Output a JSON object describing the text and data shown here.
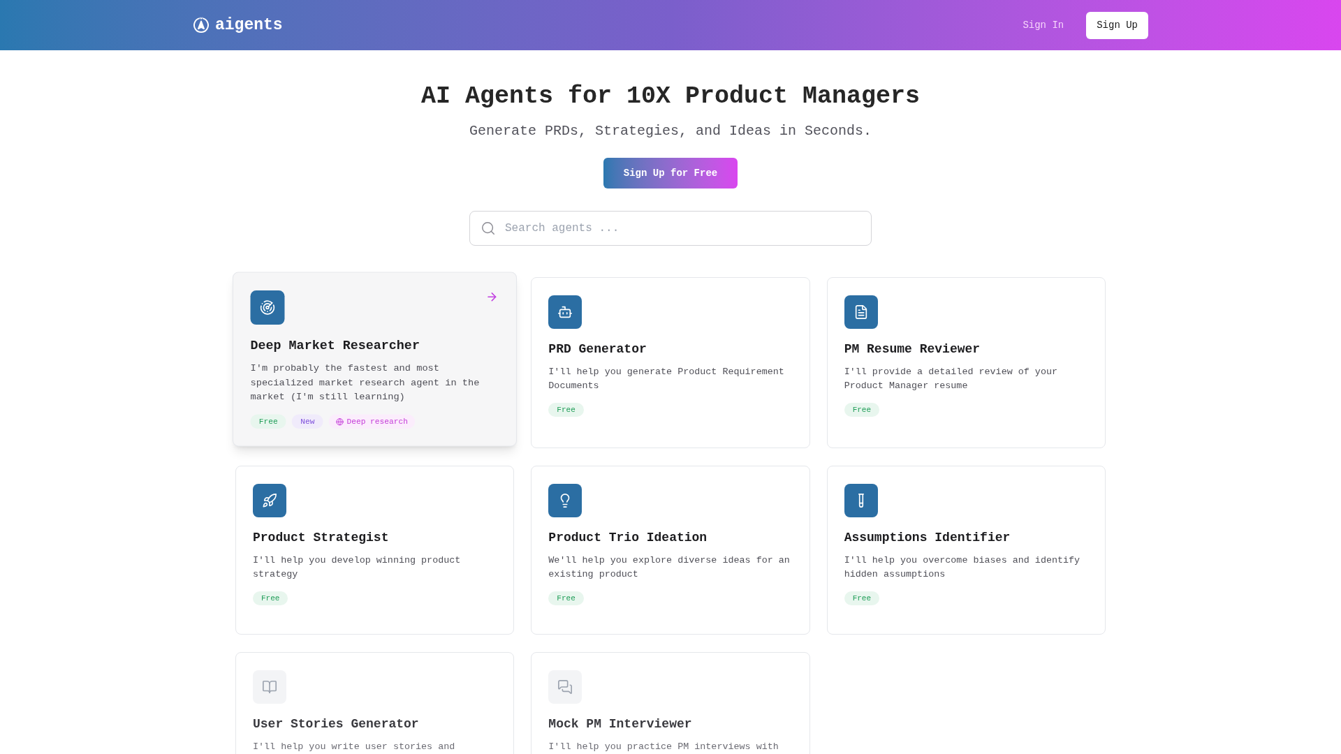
{
  "header": {
    "logo": "aigents",
    "sign_in": "Sign In",
    "sign_up": "Sign Up"
  },
  "hero": {
    "title": "AI Agents for 10X Product Managers",
    "subtitle": "Generate PRDs, Strategies, and Ideas in Seconds.",
    "cta": "Sign Up for Free"
  },
  "search": {
    "placeholder": "Search agents ..."
  },
  "agents": [
    {
      "name": "Deep Market Researcher",
      "description": "I'm probably the fastest and most specialized market research agent in the market (I'm still learning)",
      "highlighted": true,
      "disabled": false,
      "badges": [
        {
          "label": "Free",
          "kind": "free"
        },
        {
          "label": "New",
          "kind": "new"
        },
        {
          "label": "Deep research",
          "kind": "feature"
        }
      ]
    },
    {
      "name": "PRD Generator",
      "description": "I'll help you generate Product Requirement Documents",
      "highlighted": false,
      "disabled": false,
      "badges": [
        {
          "label": "Free",
          "kind": "free"
        }
      ]
    },
    {
      "name": "PM Resume Reviewer",
      "description": "I'll provide a detailed review of your Product Manager resume",
      "highlighted": false,
      "disabled": false,
      "badges": [
        {
          "label": "Free",
          "kind": "free"
        }
      ]
    },
    {
      "name": "Product Strategist",
      "description": "I'll help you develop winning product strategy",
      "highlighted": false,
      "disabled": false,
      "badges": [
        {
          "label": "Free",
          "kind": "free"
        }
      ]
    },
    {
      "name": "Product Trio Ideation",
      "description": "We'll help you explore diverse ideas for an existing product",
      "highlighted": false,
      "disabled": false,
      "badges": [
        {
          "label": "Free",
          "kind": "free"
        }
      ]
    },
    {
      "name": "Assumptions Identifier",
      "description": "I'll help you overcome biases and identify hidden assumptions",
      "highlighted": false,
      "disabled": false,
      "badges": [
        {
          "label": "Free",
          "kind": "free"
        }
      ]
    },
    {
      "name": "User Stories Generator",
      "description": "I'll help you write user stories and",
      "highlighted": false,
      "disabled": true
    },
    {
      "name": "Mock PM Interviewer",
      "description": "I'll help you practice PM interviews with",
      "highlighted": false,
      "disabled": true
    }
  ]
}
